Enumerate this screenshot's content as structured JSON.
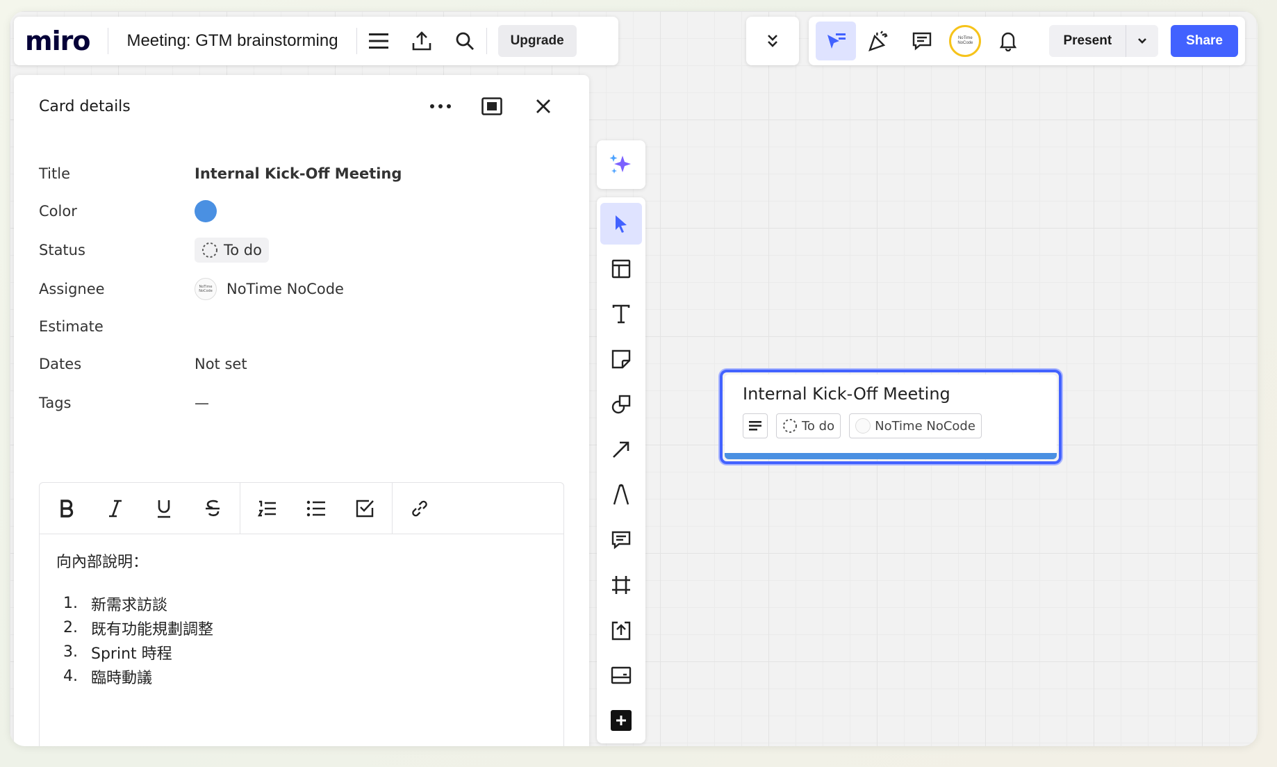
{
  "app": {
    "logo": "miro",
    "board_title": "Meeting: GTM brainstorming",
    "upgrade_label": "Upgrade",
    "present_label": "Present",
    "share_label": "Share",
    "avatar_text": "NoTime NoCode"
  },
  "panel": {
    "title": "Card details",
    "fields": {
      "title_label": "Title",
      "title_value": "Internal Kick-Off Meeting",
      "color_label": "Color",
      "color_value": "#4a90e2",
      "status_label": "Status",
      "status_value": "To do",
      "assignee_label": "Assignee",
      "assignee_value": "NoTime NoCode",
      "estimate_label": "Estimate",
      "dates_label": "Dates",
      "dates_value": "Not set",
      "tags_label": "Tags",
      "tags_value": "—"
    },
    "editor": {
      "intro": "向內部說明：",
      "items": [
        {
          "num": "1.",
          "text": "新需求訪談"
        },
        {
          "num": "2.",
          "text": "既有功能規劃調整"
        },
        {
          "num": "3.",
          "text": "Sprint 時程"
        },
        {
          "num": "4.",
          "text": "臨時動議"
        }
      ]
    }
  },
  "card": {
    "title": "Internal Kick-Off Meeting",
    "status": "To do",
    "assignee": "NoTime NoCode"
  },
  "colors": {
    "accent": "#4262ff",
    "card_color": "#4a90e2",
    "active_tool_bg": "#dfe3ff"
  }
}
